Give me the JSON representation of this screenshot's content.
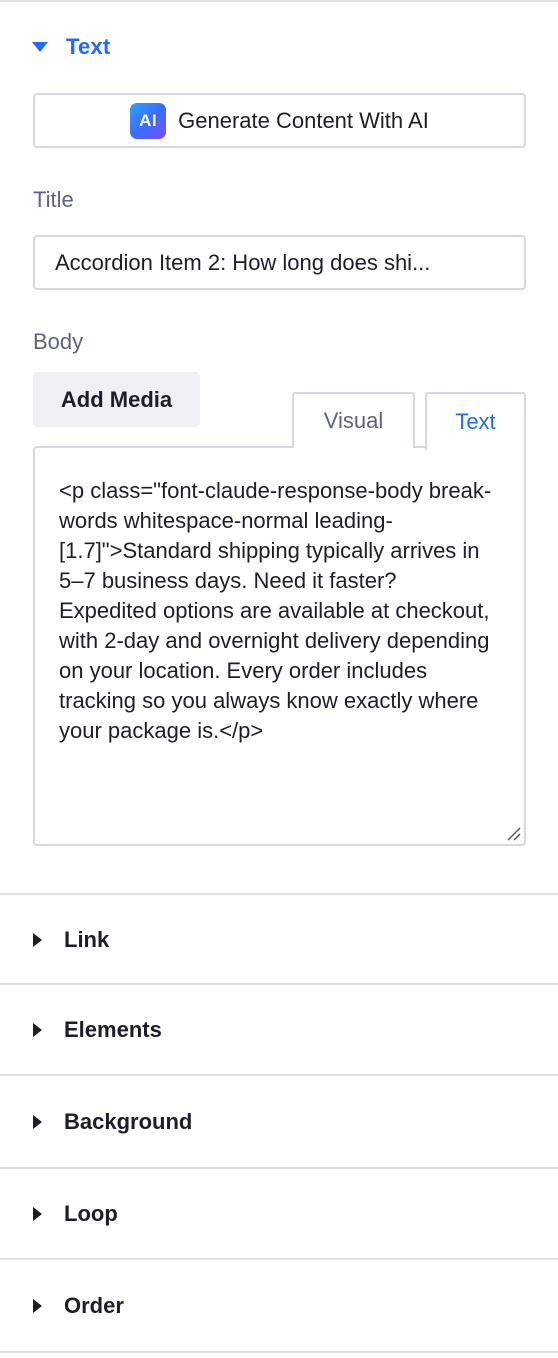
{
  "text_section": {
    "title": "Text",
    "ai_button_label": "Generate Content With AI",
    "ai_badge": "AI",
    "title_label": "Title",
    "title_value": "Accordion Item 2: How long does shi...",
    "body_label": "Body",
    "add_media_label": "Add Media",
    "tabs": [
      "Visual",
      "Text"
    ],
    "active_tab": "Text",
    "body_value": "<p class=\"font-claude-response-body break-words whitespace-normal leading-[1.7]\">Standard shipping typically arrives in 5–7 business days. Need it faster? Expedited options are available at checkout, with 2-day and overnight delivery depending on your location. Every order includes tracking so you always know exactly where your package is.</p>"
  },
  "collapsed_sections": [
    {
      "label": "Link"
    },
    {
      "label": "Elements"
    },
    {
      "label": "Background"
    },
    {
      "label": "Loop"
    },
    {
      "label": "Order"
    }
  ],
  "icons": {
    "expanded": "caret-down-icon",
    "collapsed": "caret-right-icon",
    "ai": "ai-badge-icon",
    "resize": "resize-grip-icon"
  },
  "colors": {
    "accent": "#1f6bff",
    "label": "#5b6480",
    "border": "#d6d9e2",
    "text": "#1e1e2a"
  }
}
